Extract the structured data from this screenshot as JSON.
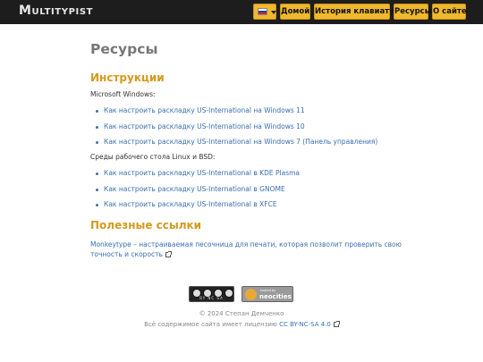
{
  "nav": {
    "brand": "Multitypist",
    "language_flag_colors": [
      "#ffffff",
      "#1c3fa8",
      "#d52b1e"
    ],
    "home": "Домой",
    "history": "История клавиатур",
    "resources": "Ресурсы",
    "about": "О сайте"
  },
  "page": {
    "title": "Ресурсы",
    "instructions": {
      "heading": "Инструкции",
      "windows_label": "Microsoft Windows:",
      "windows_links": [
        "Как настроить раскладку US-International на Windows 11",
        "Как настроить раскладку US-International на Windows 10",
        "Как настроить раскладку US-International на Windows 7 (Панель управления)"
      ],
      "linux_label": "Среды рабочего стола Linux и BSD:",
      "linux_links": [
        "Как настроить раскладку US-International в KDE Plasma",
        "Как настроить раскладку US-International в GNOME",
        "Как настроить раскладку US-International в XFCE"
      ]
    },
    "useful": {
      "heading": "Полезные ссылки",
      "monkeytype_line1": "Monkeytype – настраиваемая песочница для печати, которая позволит проверить свою",
      "monkeytype_line2": "точность и скорость"
    }
  },
  "footer": {
    "cc_badge_text": "BY NC SA",
    "neocities_small": "hosted by",
    "neocities_name": "neocities",
    "copyright": "© 2024 Степан Демченко",
    "license_prefix": "Всё содержимое сайта имеет лицензию",
    "license_link": "CC BY-NC-SA 4.0"
  }
}
